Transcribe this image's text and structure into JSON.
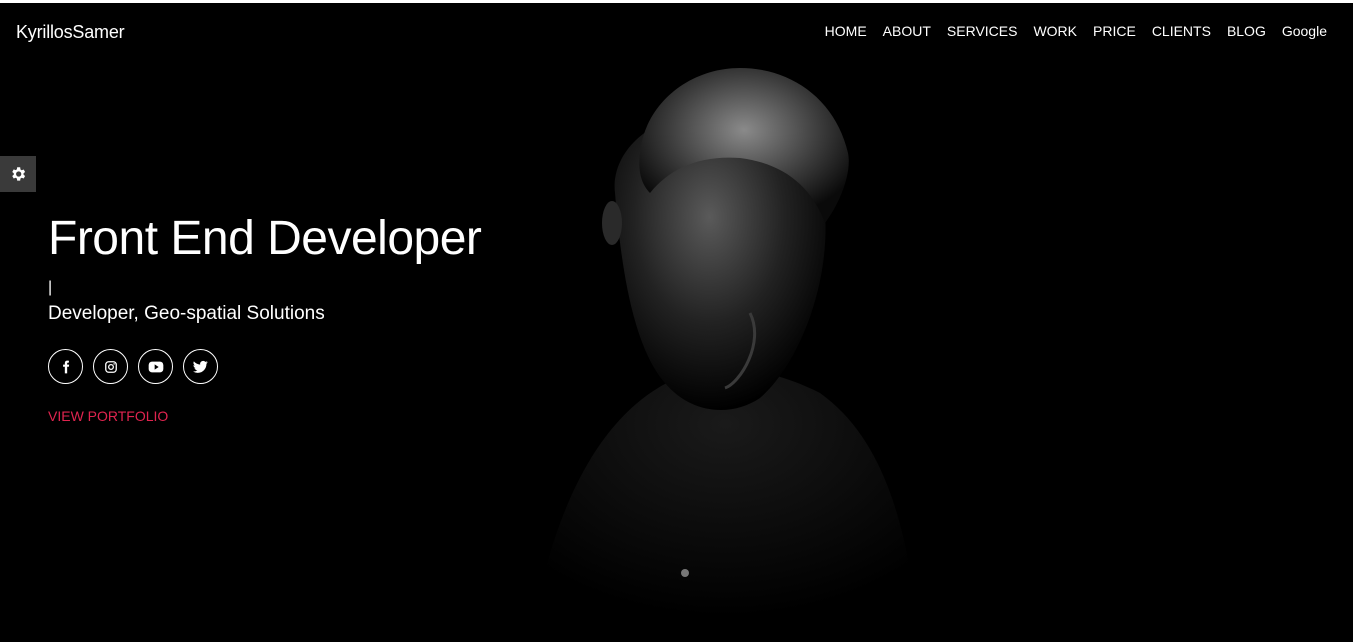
{
  "brand": "KyrillosSamer",
  "nav": {
    "items": [
      {
        "label": "HOME"
      },
      {
        "label": "ABOUT"
      },
      {
        "label": "SERVICES"
      },
      {
        "label": "WORK"
      },
      {
        "label": "PRICE"
      },
      {
        "label": "CLIENTS"
      },
      {
        "label": "BLOG"
      },
      {
        "label": "Google"
      }
    ]
  },
  "hero": {
    "title": "Front End Developer",
    "cursor": "|",
    "subtitle": "Developer, Geo-spatial Solutions",
    "cta_label": "VIEW PORTFOLIO"
  },
  "social": [
    {
      "icon": "facebook-icon"
    },
    {
      "icon": "instagram-icon"
    },
    {
      "icon": "youtube-icon"
    },
    {
      "icon": "twitter-icon"
    }
  ],
  "settings": {
    "icon": "gear-icon"
  },
  "colors": {
    "background": "#000000",
    "text": "#ffffff",
    "accent": "#e0244f",
    "settings_panel": "#3a3a3a"
  }
}
